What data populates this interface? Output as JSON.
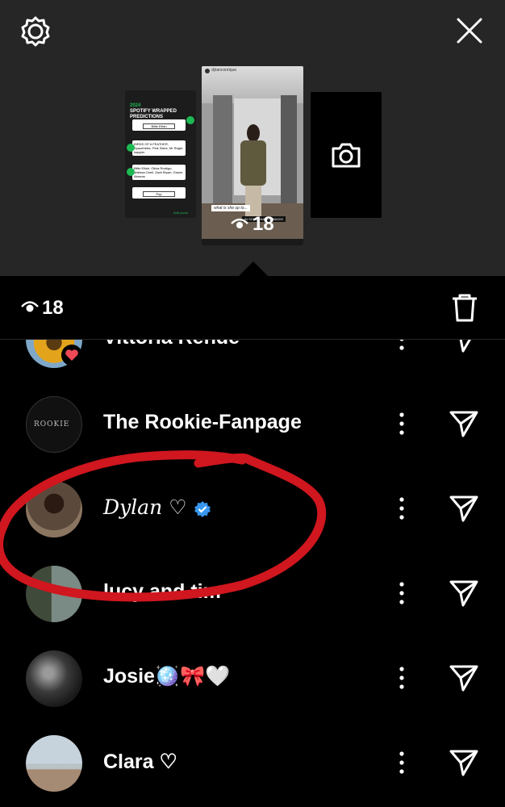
{
  "header": {
    "settings_icon": "gear-icon",
    "close_icon": "close-icon"
  },
  "thumbnails": {
    "prev_story": {
      "year": "2024",
      "title": "SPOTIFY WRAPPED PREDICTIONS",
      "answer_1": "Billie Eilish",
      "answer_2": "BIRDS OF A FEATHER, Spacehkies, Pink Skies, Mr Rager, happier",
      "answer_3": "Billie Eilish, Olivia Rodrigo, Malissa Oneil, Zack Bryan, Gracie Abrams",
      "answer_4": "Pop",
      "footer": "Add yours"
    },
    "current_story": {
      "username": "dylanconrique",
      "caption": "what is she up to...",
      "banner": "IN SOMETIMES IS BACK!!",
      "views": "18"
    },
    "add_story_icon": "camera-icon"
  },
  "viewers_bar": {
    "count": "18",
    "delete_icon": "trash-icon"
  },
  "viewers": [
    {
      "name": "Vittoria Rende",
      "liked": true
    },
    {
      "name": "The Rookie-Fanpage",
      "avatar_text": "ROOKIE"
    },
    {
      "name": "Dylan ♡",
      "verified": true
    },
    {
      "name": "lucy and tim"
    },
    {
      "name": "Josie🪩🎀🤍"
    },
    {
      "name": "Clara ♡"
    }
  ],
  "colors": {
    "top_bg": "#262626",
    "list_bg": "#000000",
    "accent_blue": "#3897F0",
    "like_red": "#ED4956",
    "annotation_red": "#D0161E",
    "spotify_green": "#1DB954"
  }
}
